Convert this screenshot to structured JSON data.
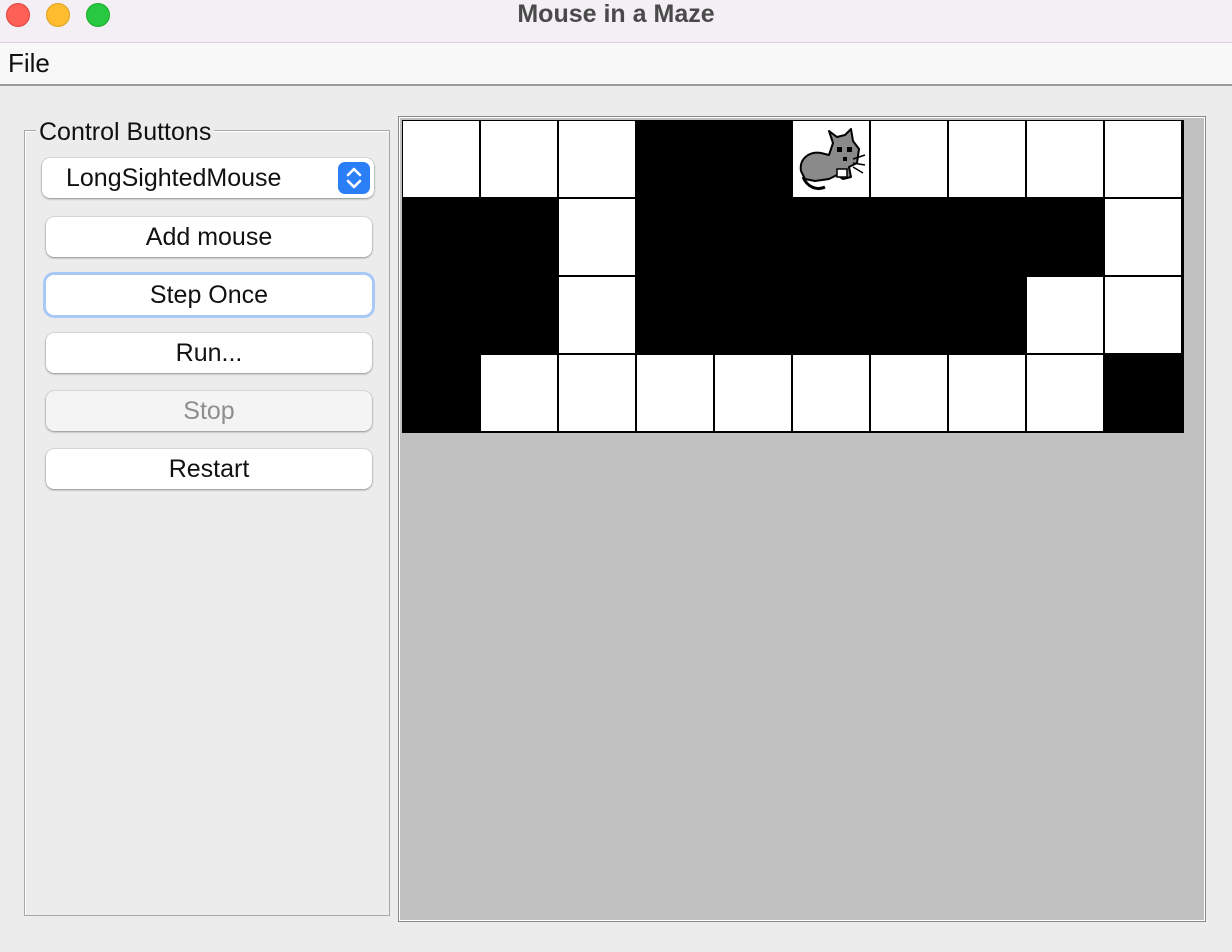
{
  "window": {
    "title": "Mouse in a Maze"
  },
  "menu": {
    "file_label": "File"
  },
  "controls": {
    "legend": "Control Buttons",
    "mouse_type_selected": "LongSightedMouse",
    "add_mouse_label": "Add mouse",
    "step_once_label": "Step Once",
    "run_label": "Run...",
    "stop_label": "Stop",
    "restart_label": "Restart"
  },
  "maze": {
    "rows": [
      [
        0,
        0,
        0,
        1,
        1,
        0,
        0,
        0,
        0,
        0
      ],
      [
        1,
        1,
        0,
        1,
        1,
        1,
        1,
        1,
        1,
        0
      ],
      [
        1,
        1,
        0,
        1,
        1,
        1,
        1,
        1,
        0,
        0
      ],
      [
        1,
        0,
        0,
        0,
        0,
        0,
        0,
        0,
        0,
        1
      ]
    ],
    "mouse_position": {
      "row": 0,
      "col": 5
    }
  },
  "colors": {
    "wall": "#000000",
    "open": "#ffffff",
    "maze_background": "#c0c0c0",
    "accent": "#2a7ff6"
  },
  "icons": {
    "window_close": "close-icon",
    "window_minimize": "minimize-icon",
    "window_zoom": "zoom-icon",
    "select_arrows": "chevron-up-down-icon",
    "mouse": "mouse-sprite-icon"
  }
}
